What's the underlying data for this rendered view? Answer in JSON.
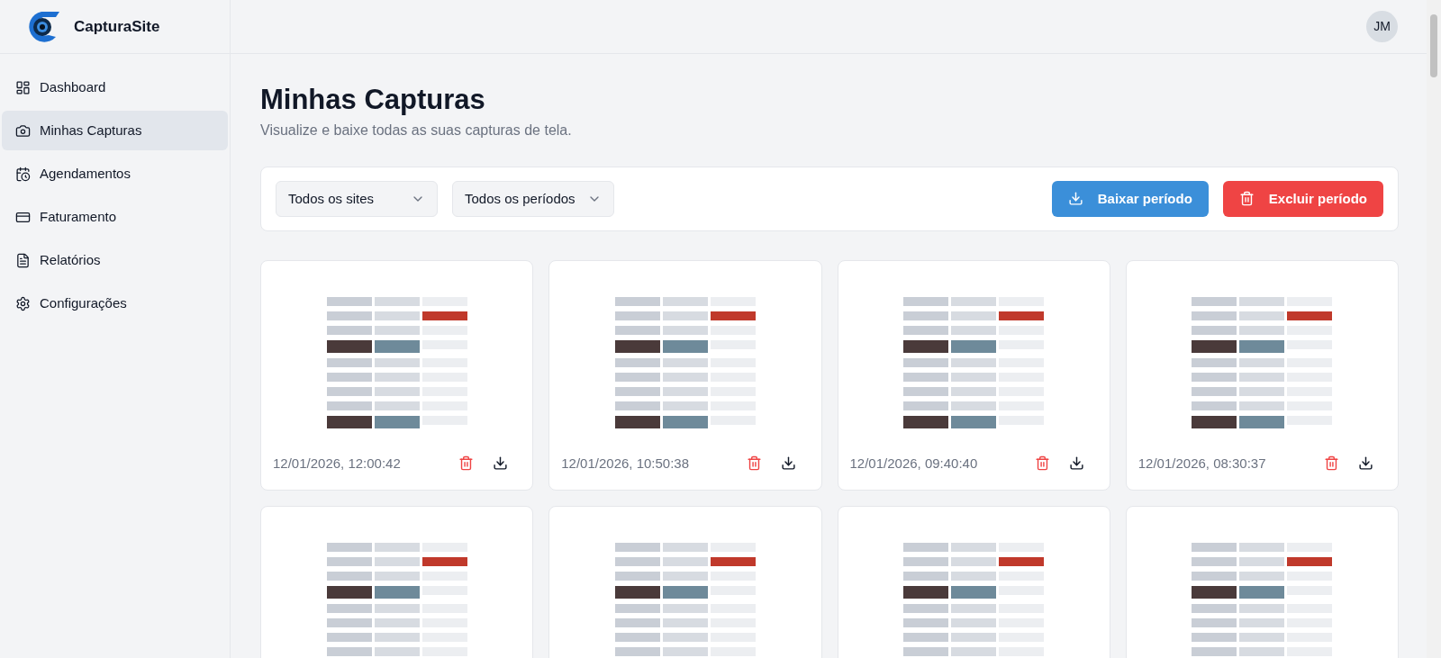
{
  "brand": {
    "name": "CapturaSite"
  },
  "user": {
    "initials": "JM"
  },
  "sidebar": {
    "items": [
      {
        "label": "Dashboard",
        "selected": false
      },
      {
        "label": "Minhas Capturas",
        "selected": true
      },
      {
        "label": "Agendamentos",
        "selected": false
      },
      {
        "label": "Faturamento",
        "selected": false
      },
      {
        "label": "Relatórios",
        "selected": false
      },
      {
        "label": "Configurações",
        "selected": false
      }
    ]
  },
  "page": {
    "title": "Minhas Capturas",
    "subtitle": "Visualize e baixe todas as suas capturas de tela."
  },
  "filters": {
    "site": "Todos os sites",
    "period": "Todos os períodos",
    "download_button": "Baixar período",
    "delete_button": "Excluir período"
  },
  "captures": [
    {
      "kind": "full",
      "timestamp": "12/01/2026, 12:00:42"
    },
    {
      "kind": "full",
      "timestamp": "12/01/2026, 10:50:38"
    },
    {
      "kind": "full",
      "timestamp": "12/01/2026, 09:40:40"
    },
    {
      "kind": "full",
      "timestamp": "12/01/2026, 08:30:37"
    },
    {
      "kind": "cropped"
    },
    {
      "kind": "cropped"
    },
    {
      "kind": "cropped"
    },
    {
      "kind": "cropped"
    }
  ]
}
